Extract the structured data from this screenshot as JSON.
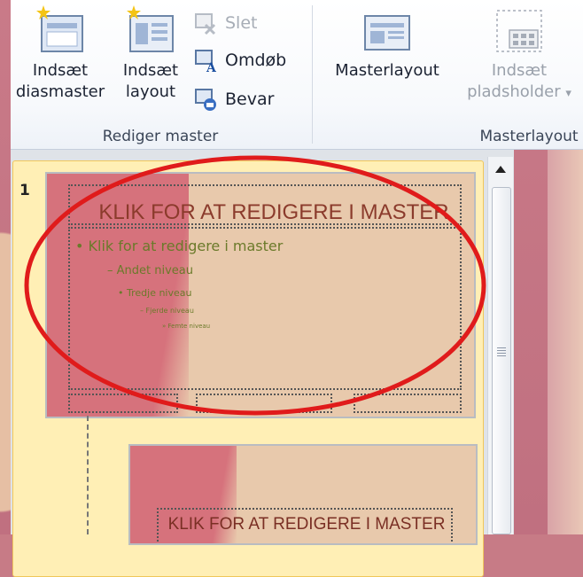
{
  "ribbon": {
    "groups": [
      {
        "label": "Rediger master",
        "big_buttons": [
          {
            "label_line1": "Indsæt",
            "label_line2": "diasmaster",
            "icon": "insert-slide-master-icon"
          },
          {
            "label_line1": "Indsæt",
            "label_line2": "layout",
            "icon": "insert-layout-icon"
          }
        ],
        "small_buttons": [
          {
            "label": "Slet",
            "icon": "delete-icon",
            "disabled": true
          },
          {
            "label": "Omdøb",
            "icon": "rename-icon",
            "disabled": false
          },
          {
            "label": "Bevar",
            "icon": "preserve-icon",
            "disabled": false
          }
        ]
      },
      {
        "label": "Masterlayout",
        "big_buttons": [
          {
            "label_line1": "Masterlayout",
            "label_line2": "",
            "icon": "master-layout-icon"
          },
          {
            "label_line1": "Indsæt",
            "label_line2": "pladsholder",
            "icon": "insert-placeholder-icon",
            "disabled": true,
            "dropdown": "▾"
          }
        ]
      }
    ]
  },
  "slides": [
    {
      "number": "1",
      "title": "KLIK FOR AT REDIGERE I MASTER",
      "levels": [
        "Klik for at redigere i master",
        "Andet niveau",
        "Tredje niveau",
        "Fjerde niveau",
        "Femte niveau"
      ],
      "selected": true
    },
    {
      "number": "",
      "title": "KLIK FOR AT REDIGERE I MASTER",
      "selected": false
    }
  ],
  "colors": {
    "annotation_ellipse": "#e01b1b",
    "selected_slide_bg": "#ffefb5",
    "slide_title": "#8b3b2c",
    "slide_text": "#6b7a2a"
  }
}
